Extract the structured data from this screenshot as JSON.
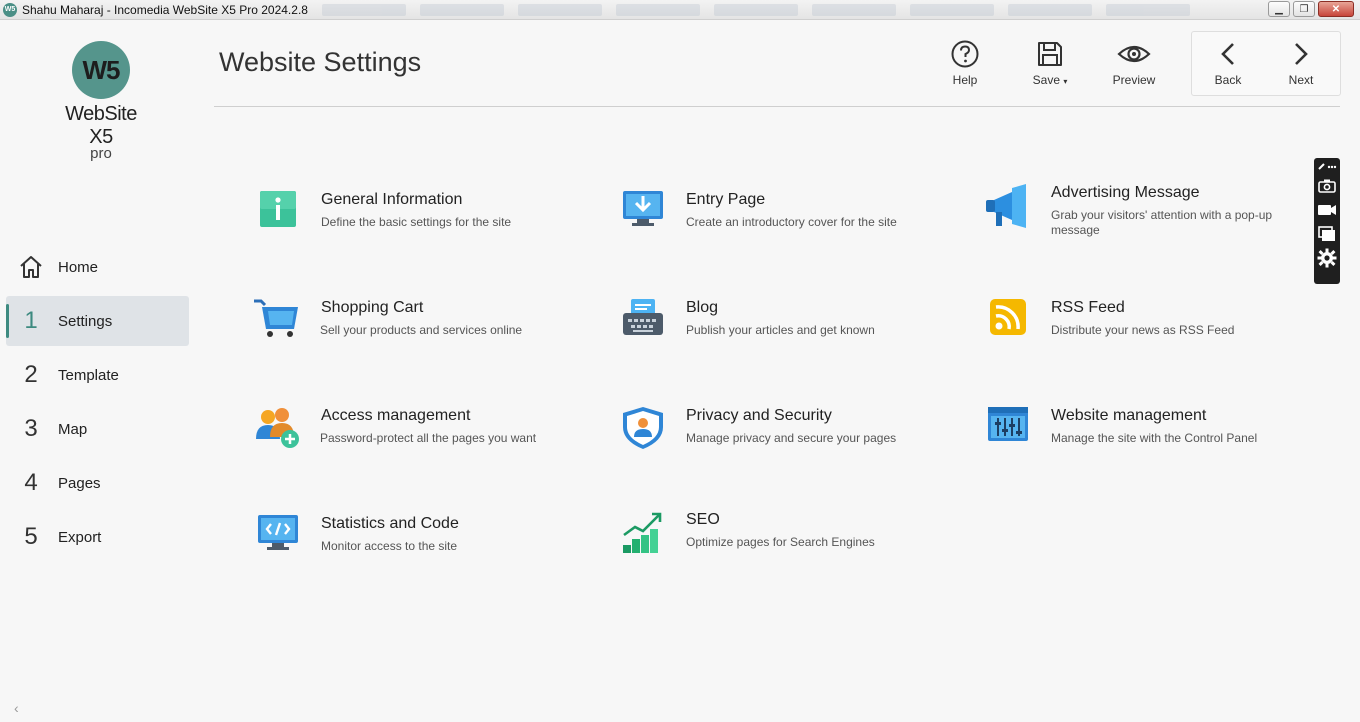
{
  "window": {
    "title": "Shahu Maharaj - Incomedia WebSite X5 Pro 2024.2.8",
    "controls": [
      "minimize",
      "restore",
      "close"
    ]
  },
  "logo": {
    "name": "WebSite X5",
    "sub": "pro",
    "mark": "W5"
  },
  "sidebar": {
    "items": [
      {
        "num": "",
        "label": "Home",
        "icon": "home-icon"
      },
      {
        "num": "1",
        "label": "Settings",
        "active": true
      },
      {
        "num": "2",
        "label": "Template"
      },
      {
        "num": "3",
        "label": "Map"
      },
      {
        "num": "4",
        "label": "Pages"
      },
      {
        "num": "5",
        "label": "Export"
      }
    ]
  },
  "header": {
    "title": "Website Settings",
    "toolbar": {
      "help": "Help",
      "save": "Save",
      "preview": "Preview",
      "back": "Back",
      "next": "Next"
    }
  },
  "cards": [
    {
      "title": "General Information",
      "desc": "Define the basic settings for the site",
      "icon": "info-icon"
    },
    {
      "title": "Entry Page",
      "desc": "Create an introductory cover for the site",
      "icon": "entry-page-icon"
    },
    {
      "title": "Advertising Message",
      "desc": "Grab your visitors' attention with a pop-up message",
      "icon": "megaphone-icon"
    },
    {
      "title": "Shopping Cart",
      "desc": "Sell your products and services online",
      "icon": "shopping-cart-icon"
    },
    {
      "title": "Blog",
      "desc": "Publish your articles and get known",
      "icon": "typewriter-icon"
    },
    {
      "title": "RSS Feed",
      "desc": "Distribute your news as RSS Feed",
      "icon": "rss-icon"
    },
    {
      "title": "Access management",
      "desc": "Password-protect all the pages you want",
      "icon": "users-add-icon"
    },
    {
      "title": "Privacy and Security",
      "desc": "Manage privacy and secure your pages",
      "icon": "shield-user-icon"
    },
    {
      "title": "Website management",
      "desc": "Manage the site with the Control Panel",
      "icon": "control-panel-icon"
    },
    {
      "title": "Statistics and Code",
      "desc": "Monitor access to the site",
      "icon": "code-monitor-icon"
    },
    {
      "title": "SEO",
      "desc": "Optimize pages for Search Engines",
      "icon": "seo-chart-icon"
    }
  ],
  "colors": {
    "accent": "#3d8a80",
    "logo": "#55958c"
  }
}
